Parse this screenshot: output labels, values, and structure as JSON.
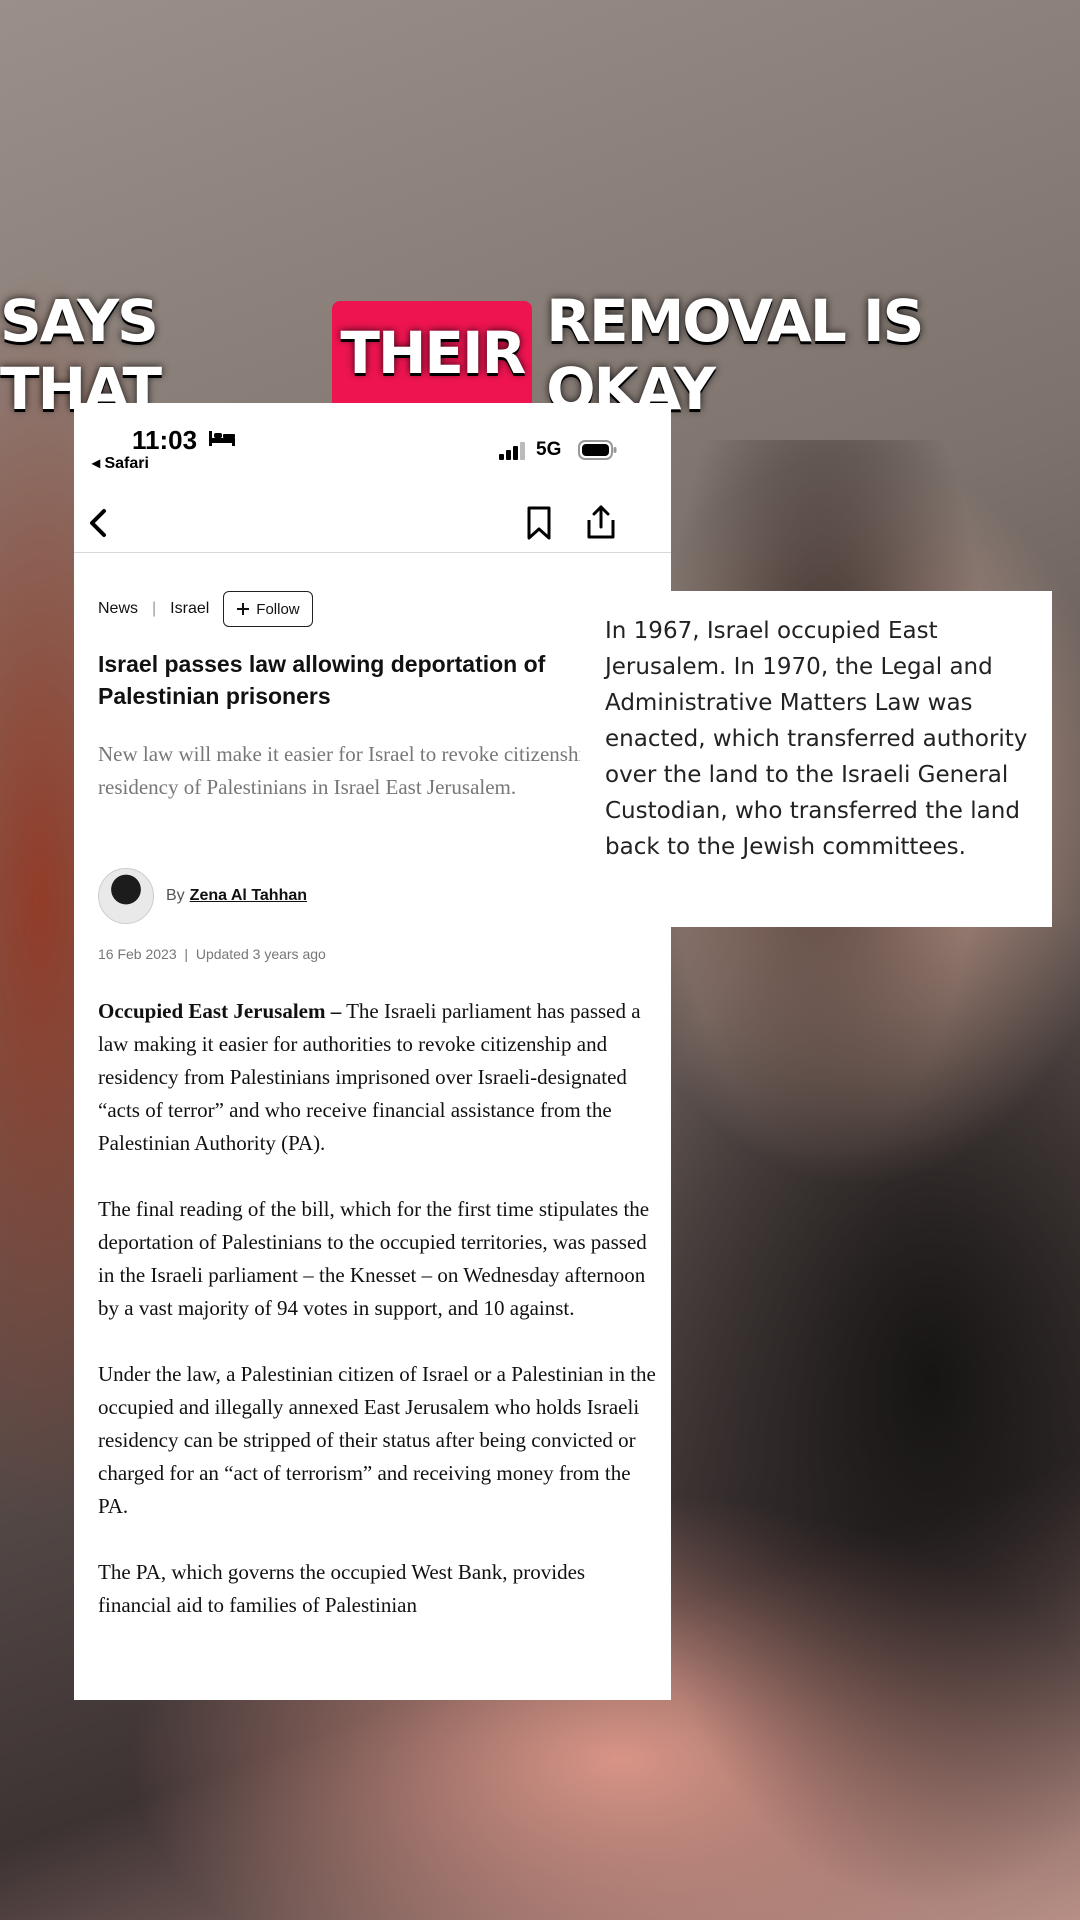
{
  "caption": {
    "before": "SAYS THAT",
    "highlight": "THEIR",
    "after": "REMOVAL IS OKAY",
    "highlight_color": "#ee1450"
  },
  "status_bar": {
    "time": "11:03",
    "back_app": "◂ Safari",
    "network": "5G",
    "icons": [
      "bed-icon",
      "signal-icon",
      "battery-icon"
    ]
  },
  "navbar": {
    "icons": [
      "chevron-left-icon",
      "bookmark-icon",
      "share-icon"
    ]
  },
  "breadcrumb": {
    "items": [
      "News",
      "Israel"
    ],
    "separator": "|",
    "follow_label": "Follow",
    "follow_icon": "plus-icon"
  },
  "article": {
    "headline": "Israel passes law allowing deportation of Palestinian prisoners",
    "standfirst": "New law will make it easier for Israel to revoke citizenship and residency of Palestinians in Israel East Jerusalem.",
    "by_label": "By",
    "author": "Zena Al Tahhan",
    "date": "16 Feb 2023",
    "updated": "Updated 3 years ago",
    "paragraphs": [
      {
        "lead": "Occupied East Jerusalem –",
        "text": " The Israeli parliament has passed a law making it easier for authorities to revoke citizenship and residency from Palestinians imprisoned over Israeli-designated “acts of terror” and who receive financial assistance from the Palestinian Authority (PA)."
      },
      {
        "text": "The final reading of the bill, which for the first time stipulates the deportation of Palestinians to the occupied territories, was passed in the Israeli parliament – the Knesset – on Wednesday afternoon by a vast majority of 94 votes in support, and 10 against."
      },
      {
        "text": "Under the law, a Palestinian citizen of Israel or a Palestinian in the occupied and illegally annexed East Jerusalem who holds Israeli residency can be stripped of their status after being convicted or charged for an “act of terrorism” and receiving money from the PA."
      },
      {
        "text": "The PA, which governs the occupied West Bank, provides financial aid to families of Palestinian"
      }
    ]
  },
  "note": {
    "text": "In 1967, Israel occupied East Jerusalem. In 1970, the Legal and Administrative Matters Law was enacted, which transferred authority over the land to the Israeli General Custodian, who transferred the land back to the Jewish committees."
  }
}
